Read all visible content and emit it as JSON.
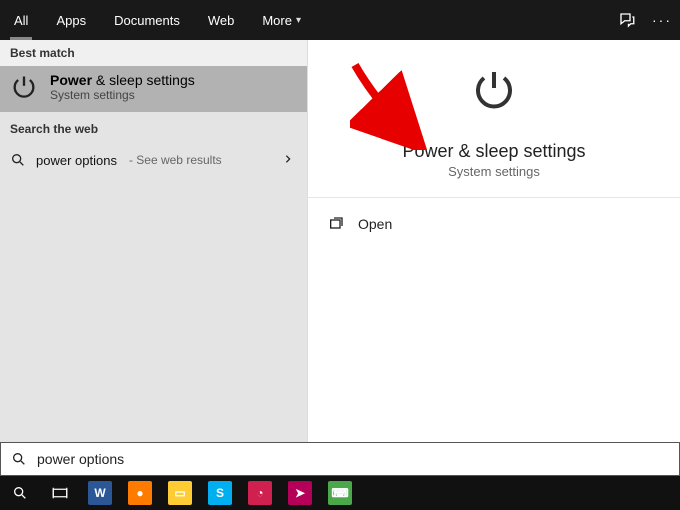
{
  "topbar": {
    "tabs": [
      "All",
      "Apps",
      "Documents",
      "Web",
      "More"
    ]
  },
  "left": {
    "best_match_label": "Best match",
    "best_match_title_bold": "Power",
    "best_match_title_rest": " & sleep settings",
    "best_match_sub": "System settings",
    "search_web_label": "Search the web",
    "web_item_text": "power options",
    "web_item_hint": "- See web results"
  },
  "right": {
    "title": "Power & sleep settings",
    "sub": "System settings",
    "open_label": "Open"
  },
  "search": {
    "value": "power options"
  },
  "taskbar": {
    "apps": [
      {
        "name": "word",
        "bg": "#2b5797",
        "glyph": "W"
      },
      {
        "name": "firefox",
        "bg": "#ff7b00",
        "glyph": "●"
      },
      {
        "name": "explorer",
        "bg": "#ffcc33",
        "glyph": "▭"
      },
      {
        "name": "skype",
        "bg": "#00aff0",
        "glyph": "S"
      },
      {
        "name": "app-red",
        "bg": "#d02050",
        "glyph": "◔"
      },
      {
        "name": "app-pink",
        "bg": "#b5005a",
        "glyph": "➤"
      },
      {
        "name": "printer",
        "bg": "#4aa84a",
        "glyph": "⌨"
      }
    ]
  }
}
